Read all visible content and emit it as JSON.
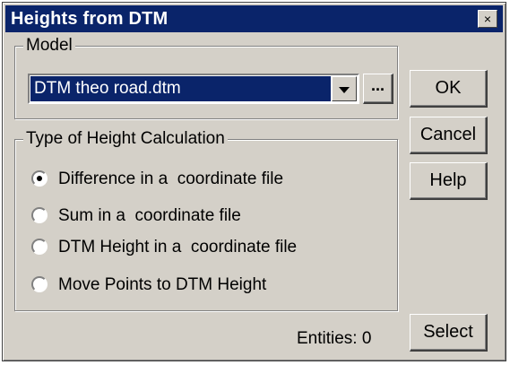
{
  "window": {
    "title": "Heights from DTM",
    "close_glyph": "×"
  },
  "model_group": {
    "label": "Model",
    "selected_file": "DTM theo road.dtm",
    "browse_label": "..."
  },
  "calc_group": {
    "label": "Type of Height Calculation",
    "options": [
      {
        "label": "Difference in a  coordinate file",
        "checked": true
      },
      {
        "label": "Sum in a  coordinate file",
        "checked": false
      },
      {
        "label": "DTM Height in a  coordinate file",
        "checked": false
      },
      {
        "label": "Move Points to DTM Height",
        "checked": false
      }
    ]
  },
  "buttons": {
    "ok": "OK",
    "cancel": "Cancel",
    "help": "Help",
    "select": "Select"
  },
  "status": {
    "entities": "Entities: 0"
  },
  "colors": {
    "titlebar": "#0a246a",
    "face": "#d4d0c8",
    "selection": "#0a246a"
  }
}
